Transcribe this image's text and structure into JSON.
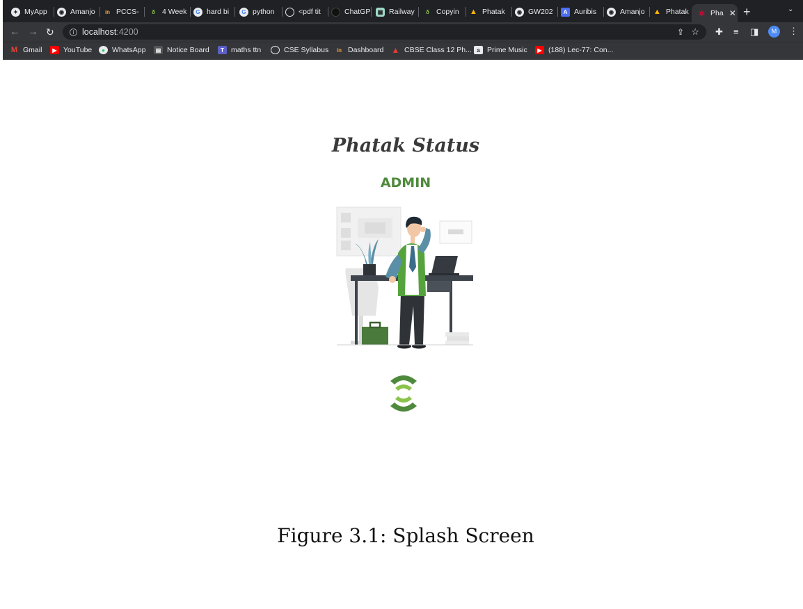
{
  "tabs": [
    {
      "label": "MyApp",
      "icon": "myapp-icon"
    },
    {
      "label": "Amanjo",
      "icon": "github-icon"
    },
    {
      "label": "PCCS-",
      "icon": "dashboard-icon"
    },
    {
      "label": "4 Week",
      "icon": "leaf-icon"
    },
    {
      "label": "hard bi",
      "icon": "google-icon"
    },
    {
      "label": "python",
      "icon": "google-icon"
    },
    {
      "label": "<pdf tit",
      "icon": "globe-icon"
    },
    {
      "label": "ChatGP",
      "icon": "chatgpt-icon"
    },
    {
      "label": "Railway",
      "icon": "railway-icon"
    },
    {
      "label": "Copyin",
      "icon": "leaf-icon"
    },
    {
      "label": "Phatak",
      "icon": "firebase-icon"
    },
    {
      "label": "GW202",
      "icon": "github-icon"
    },
    {
      "label": "Auribis",
      "icon": "auribis-icon"
    },
    {
      "label": "Amanjo",
      "icon": "github-icon"
    },
    {
      "label": "Phatak",
      "icon": "firebase-icon"
    }
  ],
  "active_tab": {
    "label": "Pha",
    "icon": "angular-icon"
  },
  "address": {
    "host": "localhost",
    "port": ":4200"
  },
  "profile_initial": "M",
  "bookmarks": [
    {
      "label": "Gmail",
      "icon": "gmail-icon"
    },
    {
      "label": "YouTube",
      "icon": "youtube-icon"
    },
    {
      "label": "WhatsApp",
      "icon": "whatsapp-icon"
    },
    {
      "label": "Notice Board",
      "icon": "noticeboard-icon"
    },
    {
      "label": "maths ttn",
      "icon": "teams-icon"
    },
    {
      "label": "CSE Syllabus",
      "icon": "globe-icon"
    },
    {
      "label": "Dashboard",
      "icon": "dashboard-icon"
    },
    {
      "label": "CBSE Class 12 Ph...",
      "icon": "cbse-icon"
    },
    {
      "label": "Prime Music",
      "icon": "amazon-icon"
    },
    {
      "label": "(188) Lec-77: Con...",
      "icon": "youtube-icon"
    }
  ],
  "page": {
    "title": "Phatak Status",
    "subtitle": "ADMIN"
  },
  "caption": "Figure 3.1: Splash Screen",
  "colors": {
    "accent_green": "#4f8a3c",
    "light_green": "#8bc34a",
    "browser_dark": "#202124"
  }
}
